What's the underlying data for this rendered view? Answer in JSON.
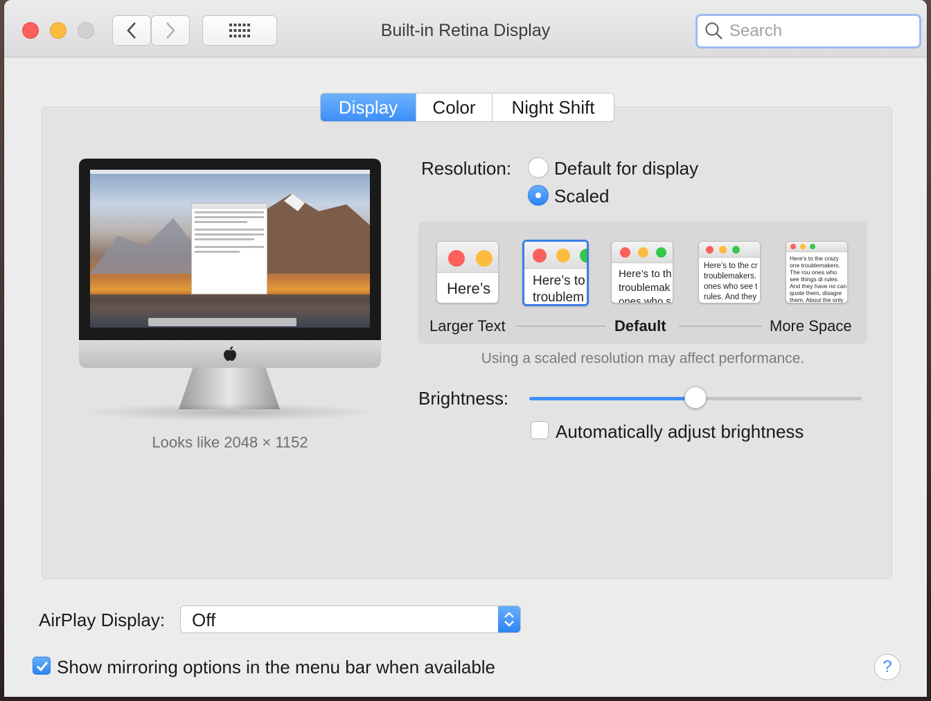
{
  "window": {
    "title": "Built-in Retina Display",
    "search_placeholder": "Search"
  },
  "tabs": [
    {
      "label": "Display",
      "active": true
    },
    {
      "label": "Color",
      "active": false
    },
    {
      "label": "Night Shift",
      "active": false
    }
  ],
  "preview": {
    "looks_like": "Looks like 2048 × 1152"
  },
  "resolution": {
    "label": "Resolution:",
    "options": [
      {
        "label": "Default for display",
        "selected": false
      },
      {
        "label": "Scaled",
        "selected": true
      }
    ]
  },
  "scaling": {
    "thumbs": [
      {
        "text": "Here’s"
      },
      {
        "text": "Here’s to troublem"
      },
      {
        "text": "Here’s to th troublemak ones who s"
      },
      {
        "text": "Here’s to the cr troublemakers. ones who see t rules. And they"
      },
      {
        "text": "Here’s to the crazy one troublemakers. The rou ones who see things di rules. And they have no can quote them, disagre them. About the only th Because they change th"
      }
    ],
    "left_label": "Larger Text",
    "middle_label": "Default",
    "right_label": "More Space",
    "note": "Using a scaled resolution may affect performance."
  },
  "brightness": {
    "label": "Brightness:",
    "value": 0.5,
    "auto_label": "Automatically adjust brightness",
    "auto_checked": false
  },
  "airplay": {
    "label": "AirPlay Display:",
    "value": "Off"
  },
  "mirroring": {
    "label": "Show mirroring options in the menu bar when available",
    "checked": true
  },
  "help": {
    "label": "?"
  },
  "colors": {
    "accent": "#3d8ef8",
    "close": "#fc605c",
    "minimize": "#fdbc40",
    "zoom": "#34c84a"
  }
}
